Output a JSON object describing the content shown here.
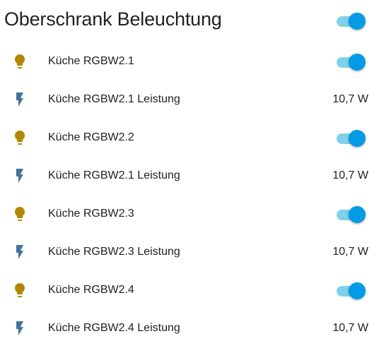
{
  "card": {
    "title": "Oberschrank Beleuchtung",
    "header_toggle_on": true
  },
  "colors": {
    "light_icon": "#b08800",
    "power_icon": "#44739e",
    "toggle_thumb": "#039be5",
    "toggle_track": "#7fd1ea",
    "text": "#212121"
  },
  "rows": [
    {
      "type": "light",
      "icon": "lightbulb-icon",
      "label": "Küche RGBW2.1",
      "state_on": true
    },
    {
      "type": "sensor",
      "icon": "flash-icon",
      "label": "Küche RGBW2.1 Leistung",
      "value": "10,7 W"
    },
    {
      "type": "light",
      "icon": "lightbulb-icon",
      "label": "Küche RGBW2.2",
      "state_on": true
    },
    {
      "type": "sensor",
      "icon": "flash-icon",
      "label": "Küche RGBW2.1 Leistung",
      "value": "10,7 W"
    },
    {
      "type": "light",
      "icon": "lightbulb-icon",
      "label": "Küche RGBW2.3",
      "state_on": true
    },
    {
      "type": "sensor",
      "icon": "flash-icon",
      "label": "Küche RGBW2.3 Leistung",
      "value": "10,7 W"
    },
    {
      "type": "light",
      "icon": "lightbulb-icon",
      "label": "Küche RGBW2.4",
      "state_on": true
    },
    {
      "type": "sensor",
      "icon": "flash-icon",
      "label": "Küche RGBW2.4 Leistung",
      "value": "10,7 W"
    }
  ]
}
